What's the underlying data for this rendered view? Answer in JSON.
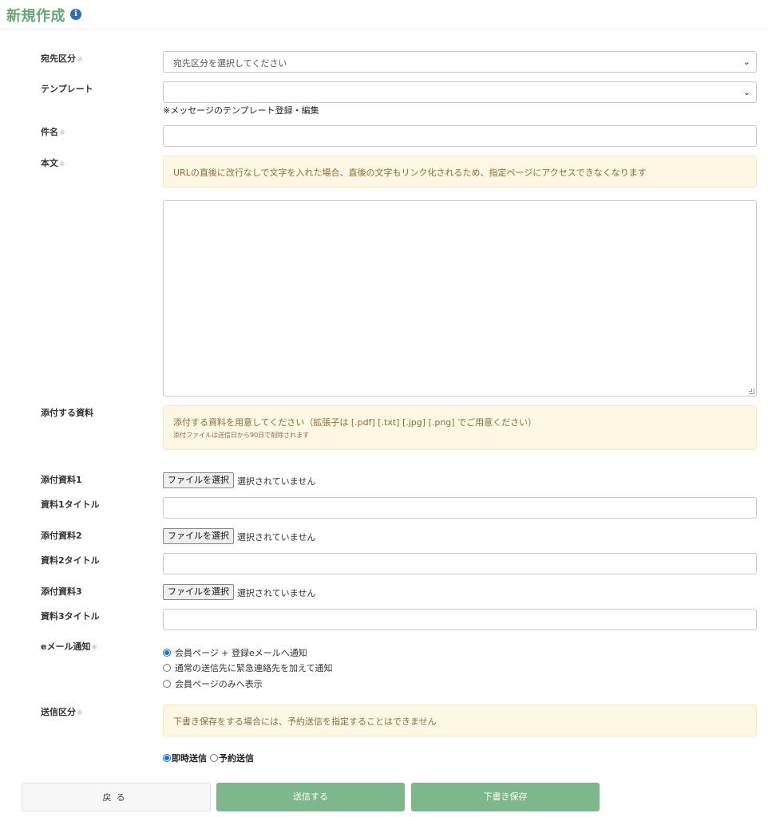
{
  "header": {
    "title": "新規作成",
    "info_glyph": "i"
  },
  "required_mark": "※",
  "fields": {
    "destination": {
      "label": "宛先区分",
      "value": "宛先区分を選択してください"
    },
    "template": {
      "label": "テンプレート",
      "value": "",
      "link": "※メッセージのテンプレート登録・編集"
    },
    "subject": {
      "label": "件名",
      "value": ""
    },
    "body": {
      "label": "本文",
      "notice": "URLの直後に改行なしで文字を入れた場合、直後の文字もリンク化されるため、指定ページにアクセスできなくなります",
      "value": ""
    },
    "attachments": {
      "label": "添付する資料",
      "notice": "添付する資料を用意してください（拡張子は [.pdf] [.txt] [.jpg] [.png] でご用意ください）",
      "notice_sub": "添付ファイルは送信日から90日で削除されます",
      "items": [
        {
          "file_label": "添付資料1",
          "title_label": "資料1タイトル"
        },
        {
          "file_label": "添付資料2",
          "title_label": "資料2タイトル"
        },
        {
          "file_label": "添付資料3",
          "title_label": "資料3タイトル"
        }
      ],
      "choose_button": "ファイルを選択",
      "no_file": "選択されていません"
    },
    "email_notify": {
      "label": "eメール通知",
      "options": [
        "会員ページ + 登録eメールへ通知",
        "通常の送信先に緊急連絡先を加えて通知",
        "会員ページのみへ表示"
      ],
      "selected": 0
    },
    "send_type": {
      "label": "送信区分",
      "notice": "下書き保存をする場合には、予約送信を指定することはできません",
      "options": [
        "即時送信",
        "予約送信"
      ],
      "selected": 0
    }
  },
  "buttons": {
    "back": "戻る",
    "send": "送信する",
    "draft": "下書き保存"
  },
  "colors": {
    "title": "#6aa57a",
    "primary_button": "#7fb78c",
    "alert_bg": "#fcf8e3",
    "alert_text": "#8a6d3b",
    "required": "#e7a2a2"
  }
}
